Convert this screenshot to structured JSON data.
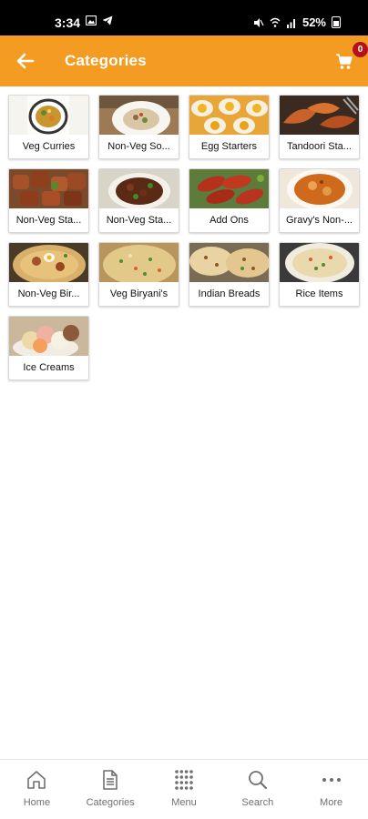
{
  "status_bar": {
    "time": "3:34",
    "battery_percent": "52%"
  },
  "header": {
    "title": "Categories",
    "cart_count": "0"
  },
  "categories": [
    {
      "label": "Veg Curries"
    },
    {
      "label": "Non-Veg So..."
    },
    {
      "label": "Egg Starters"
    },
    {
      "label": "Tandoori Sta..."
    },
    {
      "label": "Non-Veg Sta..."
    },
    {
      "label": "Non-Veg Sta..."
    },
    {
      "label": "Add Ons"
    },
    {
      "label": "Gravy's Non-..."
    },
    {
      "label": "Non-Veg Bir..."
    },
    {
      "label": "Veg Biryani's"
    },
    {
      "label": "Indian Breads"
    },
    {
      "label": "Rice Items"
    },
    {
      "label": "Ice Creams"
    }
  ],
  "bottom_nav": [
    {
      "label": "Home",
      "icon": "home-icon"
    },
    {
      "label": "Categories",
      "icon": "document-icon"
    },
    {
      "label": "Menu",
      "icon": "grid-dots-icon"
    },
    {
      "label": "Search",
      "icon": "search-icon"
    },
    {
      "label": "More",
      "icon": "more-dots-icon"
    }
  ],
  "colors": {
    "header": "#f39c21",
    "badge": "#b4121a"
  }
}
